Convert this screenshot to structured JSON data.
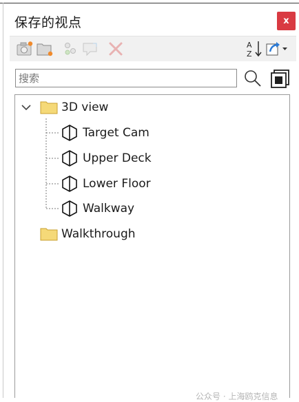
{
  "panel": {
    "title": "保存的视点",
    "close_label": "x"
  },
  "toolbar": {
    "buttons": [
      "save-viewpoint-icon",
      "new-folder-icon",
      "add-animation-icon",
      "add-cut-icon",
      "delete-icon",
      "sort-icon",
      "import-export-icon"
    ]
  },
  "search": {
    "value": "",
    "placeholder": "搜索"
  },
  "tree": {
    "items": [
      {
        "label": "3D view",
        "type": "folder",
        "expanded": true
      },
      {
        "label": "Target Cam",
        "type": "viewpoint"
      },
      {
        "label": "Upper Deck",
        "type": "viewpoint"
      },
      {
        "label": "Lower Floor",
        "type": "viewpoint"
      },
      {
        "label": "Walkway",
        "type": "viewpoint"
      },
      {
        "label": "Walkthrough",
        "type": "folder",
        "expanded": false
      }
    ]
  },
  "watermark": {
    "text": "公众号 · 上海鸥克信息"
  },
  "colors": {
    "close_bg": "#d93a42",
    "folder": "#f5d978",
    "folder_border": "#c9a030",
    "accent_blue": "#2a7ad6"
  }
}
